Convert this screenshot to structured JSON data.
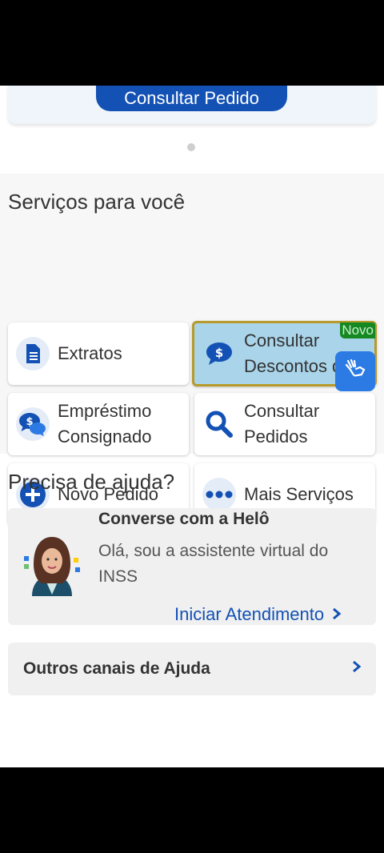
{
  "top": {
    "consult_button": "Consultar Pedido"
  },
  "services": {
    "title": "Serviços para você",
    "tiles": [
      {
        "label": "Extratos",
        "icon": "document-icon"
      },
      {
        "label": "Consultar Descontos d...",
        "icon": "dollar-speech-icon",
        "badge": "Novo"
      },
      {
        "label": "Empréstimo Consignado",
        "icon": "money-chat-icon"
      },
      {
        "label": "Consultar Pedidos",
        "icon": "search-icon"
      },
      {
        "label": "Novo Pedido",
        "icon": "plus-circle-icon"
      },
      {
        "label": "Mais Serviços",
        "icon": "more-icon"
      }
    ]
  },
  "help": {
    "title": "Precisa de ajuda?",
    "card_title": "Converse com a Helô",
    "card_desc": "Olá, sou a assistente virtual do INSS",
    "card_link": "Iniciar Atendimento",
    "other_channels": "Outros canais de Ajuda"
  },
  "colors": {
    "primary": "#1351b4",
    "highlight": "#a9d4ea",
    "badge": "#168821",
    "libras": "#2c7be5"
  }
}
